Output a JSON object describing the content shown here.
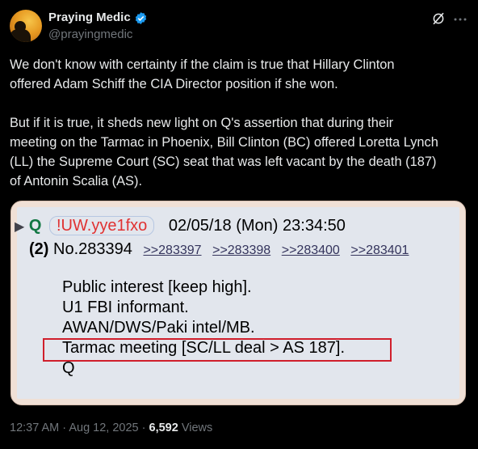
{
  "author": {
    "name": "Praying Medic",
    "handle": "@prayingmedic"
  },
  "tweet": {
    "paragraph1_lines": [
      "We don't know with certainty if the claim is true that Hillary Clinton",
      "offered Adam Schiff the CIA Director position if she won."
    ],
    "paragraph2_lines": [
      "But if it is true, it sheds new light on Q's assertion that during their",
      "meeting on the Tarmac in Phoenix, Bill Clinton (BC) offered Loretta Lynch",
      "(LL) the Supreme Court (SC) seat that was left vacant by the death (187)",
      "of Antonin Scalia (AS)."
    ]
  },
  "post": {
    "arrow": "▶",
    "q": "Q",
    "tripcode": "!UW.yye1fxo",
    "date": "02/05/18 (Mon) 23:34:50",
    "index": "(2)",
    "number": "No.283394",
    "replies": [
      ">>283397",
      ">>283398",
      ">>283400",
      ">>283401"
    ],
    "body": [
      "Public interest [keep high].",
      "U1 FBI informant.",
      "AWAN/DWS/Paki intel/MB.",
      "Tarmac meeting [SC/LL deal > AS 187].",
      "Q"
    ]
  },
  "meta": {
    "timestamp": "12:37 AM · Aug 12, 2025 · ",
    "views_count": "6,592",
    "views_label": " Views"
  },
  "colors": {
    "background": "#000000",
    "verified": "#1d9bf0",
    "highlight_box": "#d01f2c",
    "q_name": "#117743",
    "tripcode": "#e03232"
  }
}
